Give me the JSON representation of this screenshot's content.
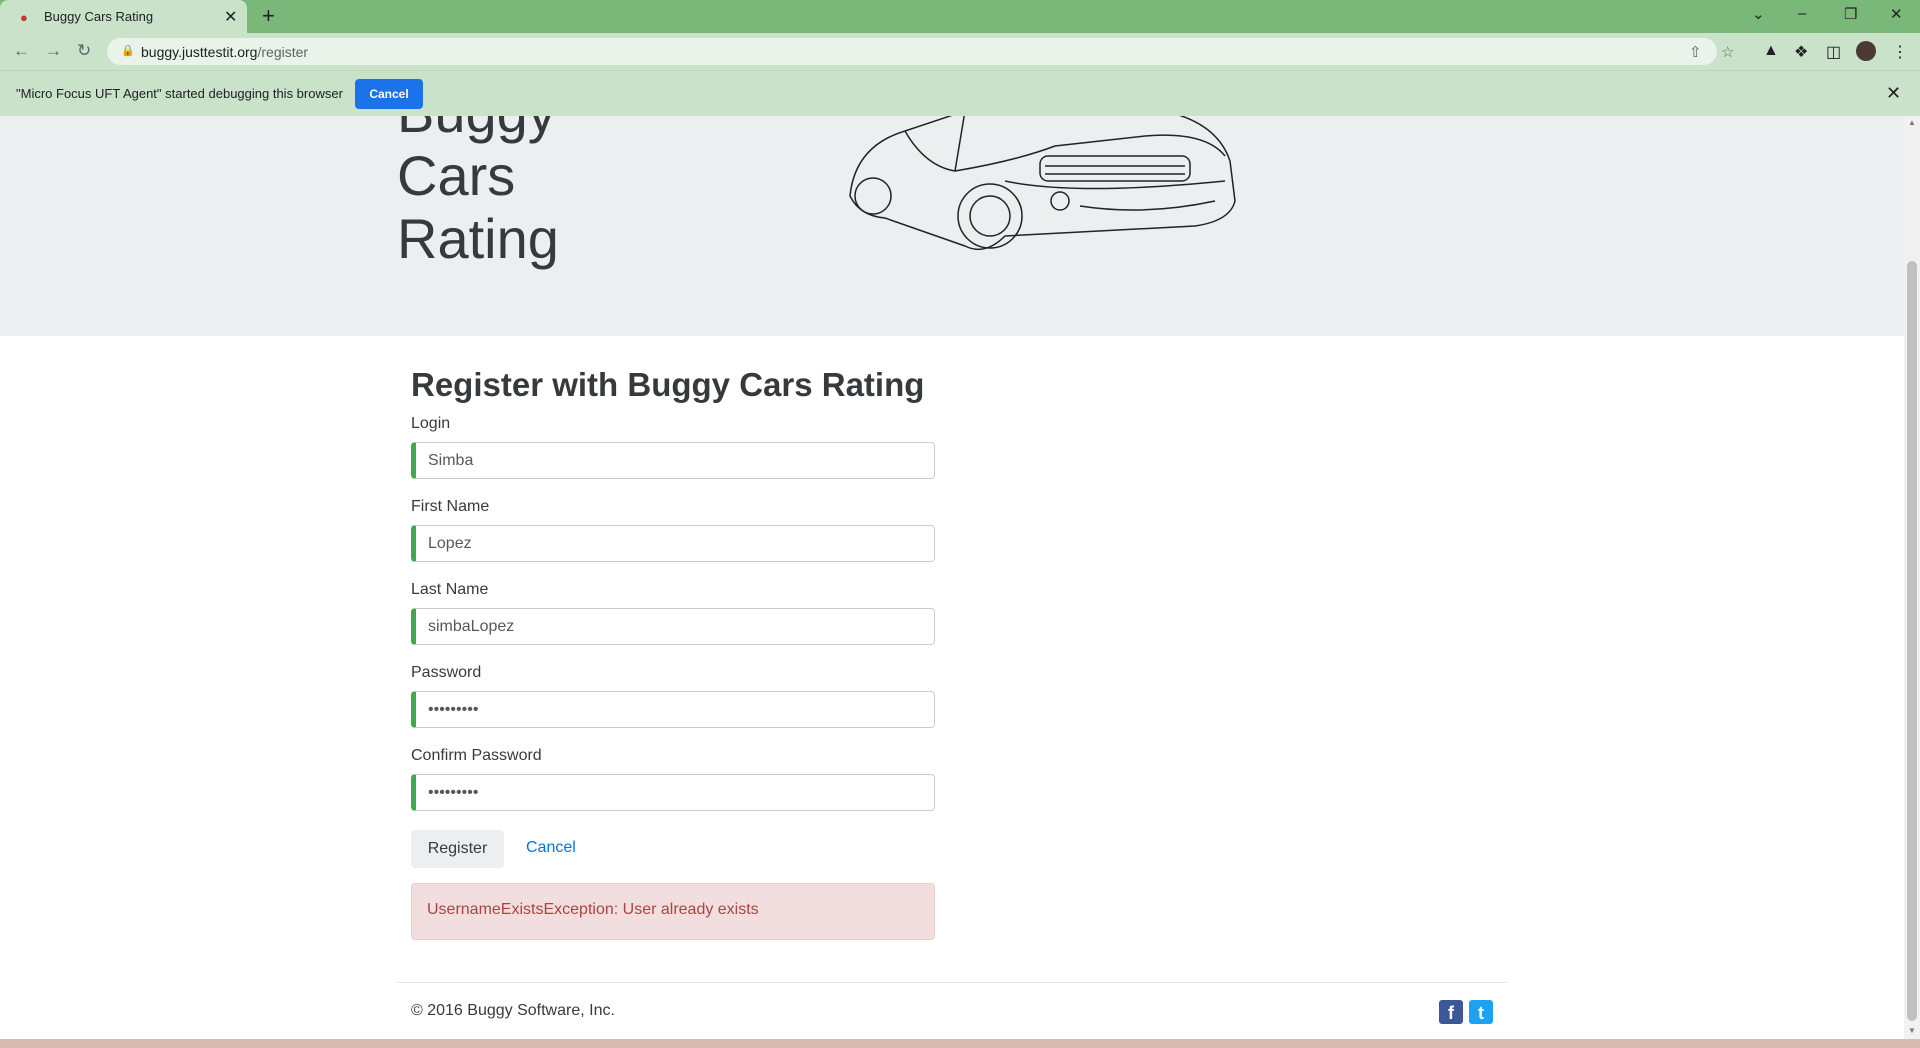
{
  "browser": {
    "tab_title": "Buggy Cars Rating",
    "tab_favicon": "car-icon",
    "url_host": "buggy.justtestit.org",
    "url_path": "/register",
    "infobar_text": "\"Micro Focus UFT Agent\" started debugging this browser",
    "infobar_cancel": "Cancel"
  },
  "header": {
    "brand_line1": "Buggy",
    "brand_line2": "Cars",
    "brand_line3": "Rating"
  },
  "form": {
    "title": "Register with Buggy Cars Rating",
    "login_label": "Login",
    "login_value": "Simba",
    "first_name_label": "First Name",
    "first_name_value": "Lopez",
    "last_name_label": "Last Name",
    "last_name_value": "simbaLopez",
    "password_label": "Password",
    "password_value": "Simba1234",
    "confirm_password_label": "Confirm Password",
    "confirm_password_value": "Simba1234",
    "register_button": "Register",
    "cancel_link": "Cancel",
    "error_message": "UsernameExistsException: User already exists"
  },
  "footer": {
    "copyright": "© 2016 Buggy Software, Inc.",
    "social": [
      "facebook-icon",
      "twitter-icon"
    ]
  },
  "colors": {
    "valid_border": "#42a948",
    "link": "#0275d8",
    "alert_bg": "#f2dede",
    "alert_text": "#a94442",
    "chrome_green": "#7ab87a"
  }
}
